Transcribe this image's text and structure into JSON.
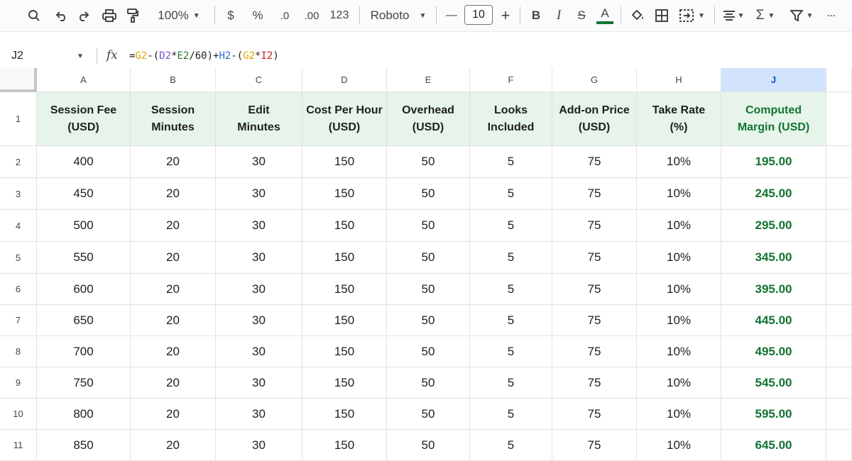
{
  "toolbar": {
    "zoom": "100%",
    "currency_symbol": "$",
    "percent_symbol": "%",
    "decrease_decimal": ".0",
    "increase_decimal": ".00",
    "number_format": "123",
    "font_name": "Roboto",
    "font_size": "10",
    "minus": "—",
    "plus": "+",
    "bold": "B",
    "italic": "I",
    "strike": "S",
    "text_color": "A",
    "sum": "Σ",
    "more": "···"
  },
  "formula_bar": {
    "cell_ref": "J2",
    "fx": "fx",
    "formula_parts": [
      "=",
      "G2",
      "-(",
      "D2",
      "*",
      "E2",
      "/60)+",
      "H2",
      "-(",
      "G2",
      "*",
      "I2",
      ")"
    ]
  },
  "columns": [
    "A",
    "B",
    "C",
    "D",
    "E",
    "F",
    "G",
    "H",
    "J"
  ],
  "header_row": [
    {
      "line1": "Session Fee",
      "line2": "(USD)"
    },
    {
      "line1": "Session",
      "line2": "Minutes"
    },
    {
      "line1": "Edit",
      "line2": "Minutes"
    },
    {
      "line1": "Cost Per Hour",
      "line2": "(USD)"
    },
    {
      "line1": "Overhead",
      "line2": "(USD)"
    },
    {
      "line1": "Looks",
      "line2": "Included"
    },
    {
      "line1": "Add-on Price",
      "line2": "(USD)"
    },
    {
      "line1": "Take Rate",
      "line2": "(%)"
    },
    {
      "line1": "Computed",
      "line2": "Margin (USD)"
    }
  ],
  "rows": [
    {
      "num": "1"
    },
    {
      "num": "2",
      "cells": [
        "400",
        "20",
        "30",
        "150",
        "50",
        "5",
        "75",
        "10%",
        "195.00"
      ]
    },
    {
      "num": "3",
      "cells": [
        "450",
        "20",
        "30",
        "150",
        "50",
        "5",
        "75",
        "10%",
        "245.00"
      ]
    },
    {
      "num": "4",
      "cells": [
        "500",
        "20",
        "30",
        "150",
        "50",
        "5",
        "75",
        "10%",
        "295.00"
      ]
    },
    {
      "num": "5",
      "cells": [
        "550",
        "20",
        "30",
        "150",
        "50",
        "5",
        "75",
        "10%",
        "345.00"
      ]
    },
    {
      "num": "6",
      "cells": [
        "600",
        "20",
        "30",
        "150",
        "50",
        "5",
        "75",
        "10%",
        "395.00"
      ]
    },
    {
      "num": "7",
      "cells": [
        "650",
        "20",
        "30",
        "150",
        "50",
        "5",
        "75",
        "10%",
        "445.00"
      ]
    },
    {
      "num": "8",
      "cells": [
        "700",
        "20",
        "30",
        "150",
        "50",
        "5",
        "75",
        "10%",
        "495.00"
      ]
    },
    {
      "num": "9",
      "cells": [
        "750",
        "20",
        "30",
        "150",
        "50",
        "5",
        "75",
        "10%",
        "545.00"
      ]
    },
    {
      "num": "10",
      "cells": [
        "800",
        "20",
        "30",
        "150",
        "50",
        "5",
        "75",
        "10%",
        "595.00"
      ]
    },
    {
      "num": "11",
      "cells": [
        "850",
        "20",
        "30",
        "150",
        "50",
        "5",
        "75",
        "10%",
        "645.00"
      ]
    }
  ],
  "colors": {
    "header_fill": "#e6f4ea",
    "margin_text": "#137333",
    "selected_column": "#d3e3fd"
  }
}
